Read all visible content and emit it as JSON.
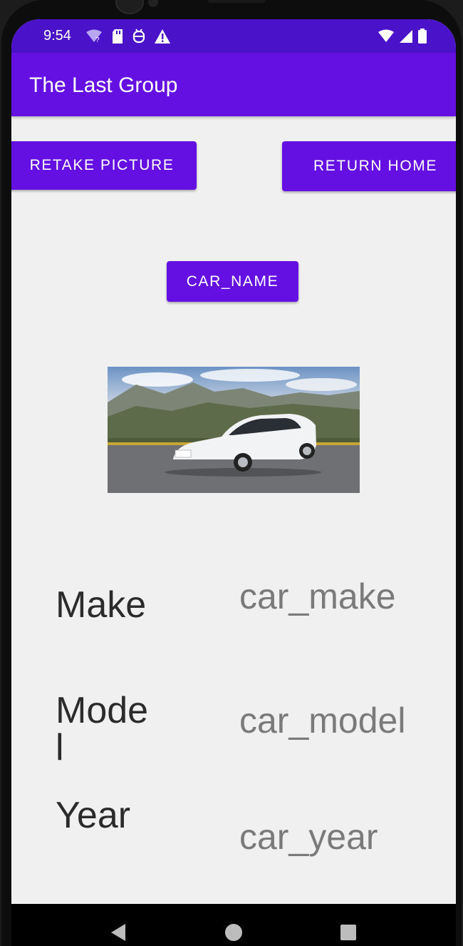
{
  "status_bar": {
    "time": "9:54",
    "left_icons": [
      "wifi-question-icon",
      "sd-card-icon",
      "robot-icon",
      "warning-icon"
    ],
    "right_icons": [
      "wifi-icon",
      "cell-signal-icon",
      "battery-icon"
    ],
    "color": "#4a12c9"
  },
  "app_bar": {
    "title": "The Last Group",
    "color": "#6510e3"
  },
  "buttons": {
    "retake": "RETAKE PICTURE",
    "home": "RETURN HOME",
    "car_name": "CAR_NAME"
  },
  "details": {
    "make_label": "Make",
    "make_value": "car_make",
    "model_label_line1": "Mode",
    "model_label_line2": "l",
    "model_value": "car_model",
    "year_label": "Year",
    "year_value": "car_year"
  },
  "nav_bar": {
    "icons": [
      "back-triangle-icon",
      "home-circle-icon",
      "recents-square-icon"
    ]
  }
}
